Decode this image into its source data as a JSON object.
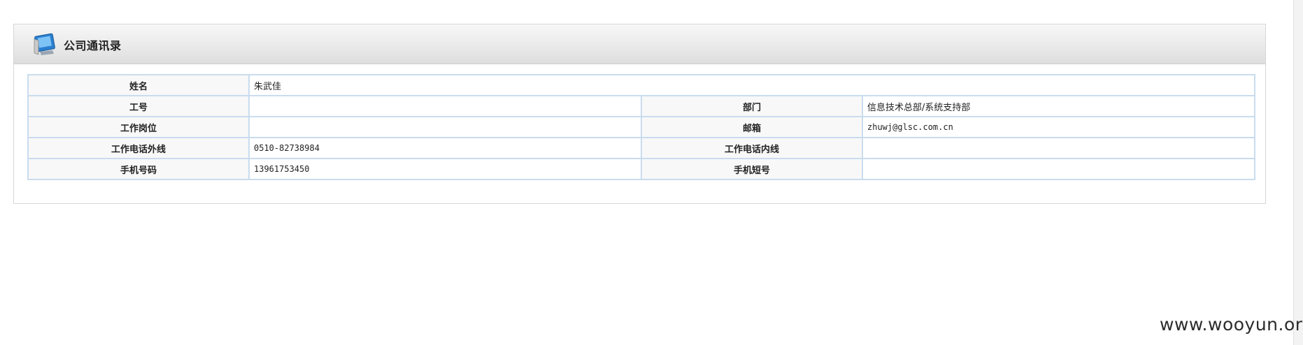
{
  "panel": {
    "title": "公司通讯录",
    "icon": "address-book-icon"
  },
  "rows": {
    "name": {
      "label": "姓名",
      "value": "朱武佳"
    },
    "employee_id": {
      "label": "工号",
      "value": ""
    },
    "department": {
      "label": "部门",
      "value": "信息技术总部/系统支持部"
    },
    "position": {
      "label": "工作岗位",
      "value": ""
    },
    "email": {
      "label": "邮箱",
      "value": "zhuwj@glsc.com.cn"
    },
    "work_phone_ext": {
      "label": "工作电话外线",
      "value": "0510-82738984"
    },
    "work_phone_int": {
      "label": "工作电话内线",
      "value": ""
    },
    "mobile": {
      "label": "手机号码",
      "value": "13961753450"
    },
    "mobile_short": {
      "label": "手机短号",
      "value": ""
    }
  },
  "watermark": "www.wooyun.org",
  "colors": {
    "border": "#c9dcef",
    "label_bg": "#f8f8f8",
    "header_bg": "#e6e6e6"
  }
}
